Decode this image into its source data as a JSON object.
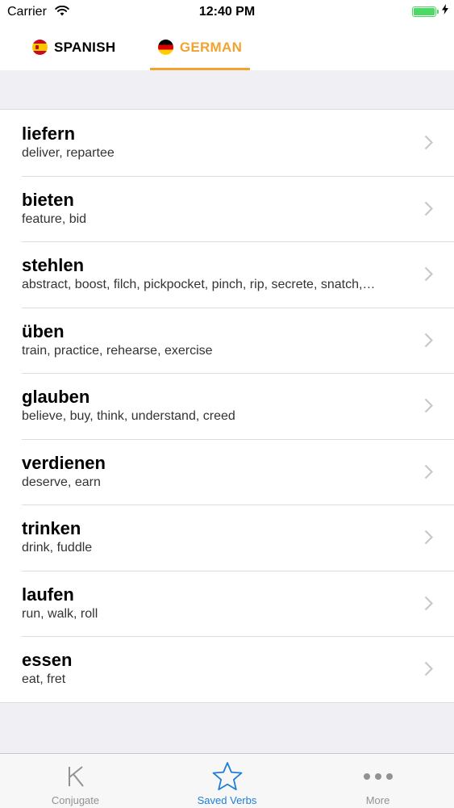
{
  "status_bar": {
    "carrier": "Carrier",
    "time": "12:40 PM",
    "battery_level": 1.0,
    "battery_color": "#4cd964"
  },
  "language_tabs": [
    {
      "label": "SPANISH",
      "flag": "spain-flag-icon",
      "selected": false
    },
    {
      "label": "GERMAN",
      "flag": "germany-flag-icon",
      "selected": true
    }
  ],
  "accent_color": "#f0a330",
  "verbs": [
    {
      "verb": "liefern",
      "translations": "deliver, repartee"
    },
    {
      "verb": "bieten",
      "translations": "feature, bid"
    },
    {
      "verb": "stehlen",
      "translations": "abstract, boost, filch, pickpocket, pinch, rip, secrete, snatch,…"
    },
    {
      "verb": "üben",
      "translations": "train, practice, rehearse, exercise"
    },
    {
      "verb": "glauben",
      "translations": "believe, buy, think, understand, creed"
    },
    {
      "verb": "verdienen",
      "translations": "deserve, earn"
    },
    {
      "verb": "trinken",
      "translations": "drink, fuddle"
    },
    {
      "verb": "laufen",
      "translations": "run, walk, roll"
    },
    {
      "verb": "essen",
      "translations": "eat, fret"
    }
  ],
  "tab_bar": {
    "items": [
      {
        "label": "Conjugate",
        "icon": "k-letter-icon",
        "selected": false
      },
      {
        "label": "Saved Verbs",
        "icon": "star-icon",
        "selected": true
      },
      {
        "label": "More",
        "icon": "more-dots-icon",
        "selected": false
      }
    ],
    "selected_color": "#1f7ed6"
  }
}
